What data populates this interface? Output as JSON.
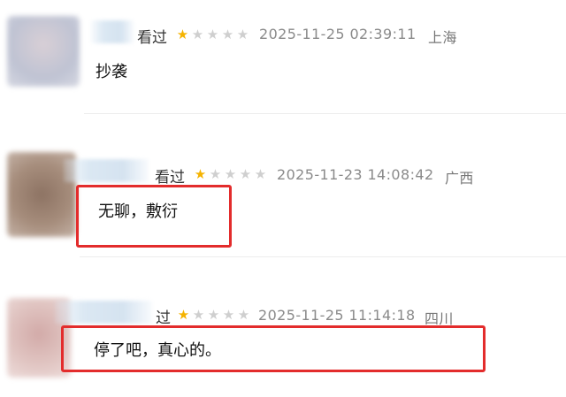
{
  "comments": [
    {
      "status": "看过",
      "rating": 1,
      "date": "2025-11-25 02:39:11",
      "region": "上海",
      "text": "抄袭",
      "avatar_color": "#c9c7d2"
    },
    {
      "status": "看过",
      "rating": 1,
      "date": "2025-11-23 14:08:42",
      "region": "广西",
      "text": "无聊，敷衍",
      "avatar_color": "#a08a78",
      "highlighted": true
    },
    {
      "status": "过",
      "rating": 1,
      "date": "2025-11-25 11:14:18",
      "region": "四川",
      "text": "停了吧，真心的。",
      "avatar_color": "#d9b9b6",
      "highlighted": true
    }
  ],
  "stars": {
    "on": "★",
    "off": "★",
    "max": 5
  },
  "colors": {
    "star_on": "#f5b300",
    "star_off": "#cfcfcf",
    "highlight": "#e32c2c"
  }
}
